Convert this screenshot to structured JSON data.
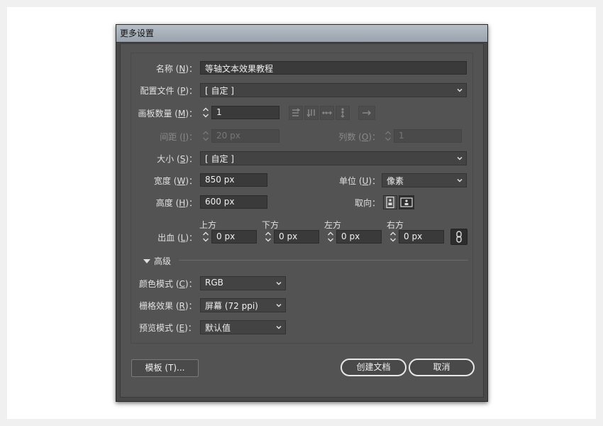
{
  "dialog": {
    "title": "更多设置"
  },
  "form": {
    "name": {
      "label": "名称",
      "key": "N",
      "value": "等轴文本效果教程"
    },
    "profile": {
      "label": "配置文件",
      "key": "P",
      "value": "[ 自定 ]"
    },
    "artboards": {
      "label": "画板数量",
      "key": "M",
      "value": "1"
    },
    "spacing": {
      "label": "间距",
      "key": "I",
      "value": "20 px"
    },
    "columns": {
      "label": "列数",
      "key": "O",
      "value": "1"
    },
    "size": {
      "label": "大小",
      "key": "S",
      "value": "[ 自定 ]"
    },
    "width": {
      "label": "宽度",
      "key": "W",
      "value": "850 px"
    },
    "units": {
      "label": "单位",
      "key": "U",
      "value": "像素"
    },
    "height": {
      "label": "高度",
      "key": "H",
      "value": "600 px"
    },
    "orientation": {
      "label": "取向："
    },
    "bleed": {
      "label": "出血",
      "key": "L",
      "top": {
        "label": "上方",
        "value": "0 px"
      },
      "bottom": {
        "label": "下方",
        "value": "0 px"
      },
      "left": {
        "label": "左方",
        "value": "0 px"
      },
      "right": {
        "label": "右方",
        "value": "0 px"
      }
    }
  },
  "advanced": {
    "title": "高级",
    "color_mode": {
      "label": "颜色模式",
      "key": "C",
      "value": "RGB"
    },
    "raster": {
      "label": "栅格效果",
      "key": "R",
      "value": "屏幕 (72 ppi)"
    },
    "preview": {
      "label": "预览模式",
      "key": "E",
      "value": "默认值"
    }
  },
  "buttons": {
    "templates": "模板 (T)...",
    "create": "创建文档",
    "cancel": "取消"
  },
  "colors": {
    "dialog_bg": "#535353",
    "field_bg": "#3a3a3a",
    "text": "#e0e0e0",
    "disabled_text": "#8a8a8a"
  }
}
